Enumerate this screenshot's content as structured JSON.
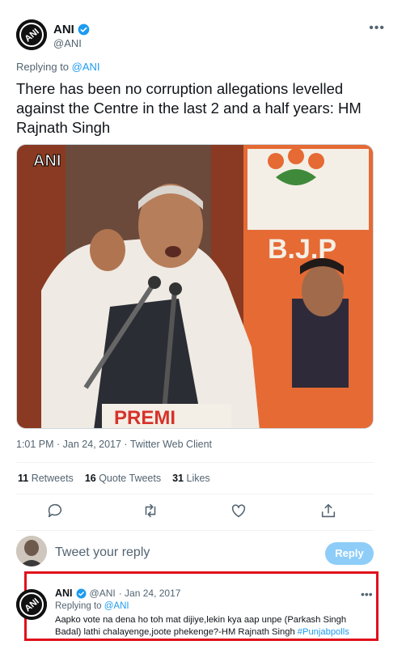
{
  "tweet": {
    "name": "ANI",
    "handle": "@ANI",
    "replying_prefix": "Replying to",
    "replying_handle": "@ANI",
    "text": "There has been no corruption allegations levelled against the Centre in the last 2 and a half years: HM Rajnath Singh",
    "media_watermark": "ANI",
    "media_banner": "B.J.P",
    "media_podium": "PREMI",
    "timestamp": "1:01 PM · Jan 24, 2017 · Twitter Web Client",
    "stats": {
      "retweets_count": "11",
      "retweets_label": "Retweets",
      "quotes_count": "16",
      "quotes_label": "Quote Tweets",
      "likes_count": "31",
      "likes_label": "Likes"
    }
  },
  "actions": [
    "reply-icon",
    "retweet-icon",
    "like-icon",
    "share-icon"
  ],
  "reply_box": {
    "placeholder": "Tweet your reply",
    "button": "Reply"
  },
  "reply_tweet": {
    "name": "ANI",
    "handle": "@ANI",
    "date": "· Jan 24, 2017",
    "replying_prefix": "Replying to",
    "replying_handle": "@ANI",
    "text": "Aapko vote na dena ho toh mat dijiye,lekin kya aap unpe (Parkash Singh Badal) lathi chalayenge,joote phekenge?-HM Rajnath Singh",
    "hashtag": "#Punjabpolls"
  },
  "colors": {
    "accent": "#1d9bf0",
    "highlight": "#e0101b"
  }
}
